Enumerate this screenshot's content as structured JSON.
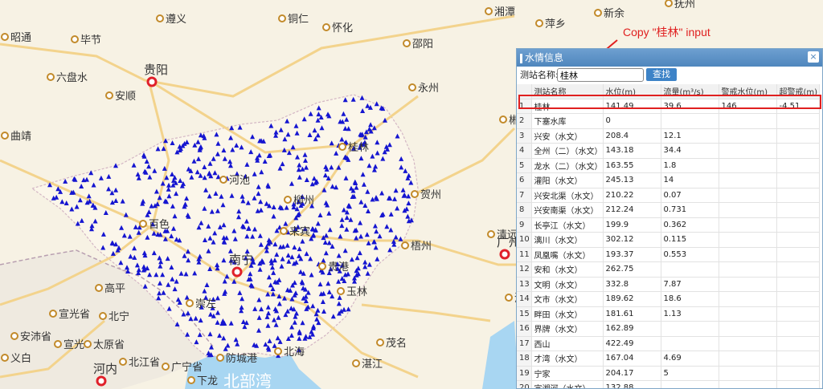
{
  "map": {
    "cities": [
      {
        "id": "zunyi",
        "name": "遵义"
      },
      {
        "id": "tongren",
        "name": "铜仁"
      },
      {
        "id": "xiangtan",
        "name": "湘潭"
      },
      {
        "id": "xinyu",
        "name": "新余"
      },
      {
        "id": "fuzhou",
        "name": "抚州"
      },
      {
        "id": "bijie",
        "name": "毕节"
      },
      {
        "id": "huaihua",
        "name": "怀化"
      },
      {
        "id": "pingxiang",
        "name": "萍乡"
      },
      {
        "id": "zhaotong",
        "name": "昭通"
      },
      {
        "id": "guiyang",
        "name": "贵阳"
      },
      {
        "id": "shaoyang",
        "name": "邵阳"
      },
      {
        "id": "liupanshui",
        "name": "六盘水"
      },
      {
        "id": "anshun",
        "name": "安顺"
      },
      {
        "id": "yongzhou",
        "name": "永州"
      },
      {
        "id": "qujing",
        "name": "曲靖"
      },
      {
        "id": "chenzhou",
        "name": "郴州"
      },
      {
        "id": "guilin",
        "name": "桂林"
      },
      {
        "id": "hechi",
        "name": "河池"
      },
      {
        "id": "liuzhou",
        "name": "柳州"
      },
      {
        "id": "hezhou",
        "name": "贺州"
      },
      {
        "id": "baise",
        "name": "百色"
      },
      {
        "id": "laibin",
        "name": "来宾"
      },
      {
        "id": "qingyuan",
        "name": "清远"
      },
      {
        "id": "wuzhou",
        "name": "梧州"
      },
      {
        "id": "nanning",
        "name": "南宁"
      },
      {
        "id": "guangzhou",
        "name": "广州"
      },
      {
        "id": "gaoping",
        "name": "高平"
      },
      {
        "id": "guigang",
        "name": "贵港"
      },
      {
        "id": "yulin",
        "name": "玉林"
      },
      {
        "id": "chongzuo",
        "name": "崇左"
      },
      {
        "id": "ao",
        "name": "澳"
      },
      {
        "id": "xuanguang_prov",
        "name": "宣光省"
      },
      {
        "id": "beining",
        "name": "北宁"
      },
      {
        "id": "anpei",
        "name": "安沛省"
      },
      {
        "id": "xuanguang",
        "name": "宣光"
      },
      {
        "id": "taiyuan",
        "name": "太原省"
      },
      {
        "id": "beijiang",
        "name": "北江省"
      },
      {
        "id": "maoming",
        "name": "茂名"
      },
      {
        "id": "fangchenggang",
        "name": "防城港"
      },
      {
        "id": "beihai",
        "name": "北海"
      },
      {
        "id": "yibai",
        "name": "义白"
      },
      {
        "id": "guangning",
        "name": "广宁省"
      },
      {
        "id": "hanoi",
        "name": "河内"
      },
      {
        "id": "zhanjiang",
        "name": "湛江"
      },
      {
        "id": "xialong",
        "name": "下龙"
      }
    ],
    "sea_label": "北部湾"
  },
  "annotation": {
    "text": "Copy \"桂林\" input"
  },
  "panel": {
    "title": "水情信息",
    "close_icon": "×",
    "search": {
      "label": "测站名称:",
      "value": "桂林",
      "button": "查找"
    },
    "columns": [
      "",
      "测站名称",
      "水位(m)",
      "流量(m³/s)",
      "警戒水位(m)",
      "超警戒(m)"
    ],
    "rows": [
      [
        "1",
        "桂林",
        "141.49",
        "39.6",
        "146",
        "-4.51"
      ],
      [
        "2",
        "下塞水库",
        "0",
        "",
        "",
        ""
      ],
      [
        "3",
        "兴安（水文）",
        "208.4",
        "12.1",
        "",
        ""
      ],
      [
        "4",
        "全州（二）（水文）",
        "143.18",
        "34.4",
        "",
        ""
      ],
      [
        "5",
        "龙水（二）（水文）",
        "163.55",
        "1.8",
        "",
        ""
      ],
      [
        "6",
        "灌阳（水文）",
        "245.13",
        "14",
        "",
        ""
      ],
      [
        "7",
        "兴安北渠（水文）",
        "210.22",
        "0.07",
        "",
        ""
      ],
      [
        "8",
        "兴安南渠（水文）",
        "212.24",
        "0.731",
        "",
        ""
      ],
      [
        "9",
        "长亭江（水文）",
        "199.9",
        "0.362",
        "",
        ""
      ],
      [
        "10",
        "漓川（水文）",
        "302.12",
        "0.115",
        "",
        ""
      ],
      [
        "11",
        "凤凰嘴（水文）",
        "193.37",
        "0.553",
        "",
        ""
      ],
      [
        "12",
        "安和（水文）",
        "262.75",
        "",
        "",
        ""
      ],
      [
        "13",
        "文明（水文）",
        "332.8",
        "7.87",
        "",
        ""
      ],
      [
        "14",
        "文市（水文）",
        "189.62",
        "18.6",
        "",
        ""
      ],
      [
        "15",
        "畔田（水文）",
        "181.61",
        "1.13",
        "",
        ""
      ],
      [
        "16",
        "界牌（水文）",
        "162.89",
        "",
        "",
        ""
      ],
      [
        "17",
        "西山",
        "422.49",
        "",
        "",
        ""
      ],
      [
        "18",
        "才湾（水文）",
        "167.04",
        "4.69",
        "",
        ""
      ],
      [
        "19",
        "宁家",
        "204.17",
        "5",
        "",
        ""
      ],
      [
        "20",
        "宣湘河（水文）",
        "132.88",
        "",
        "",
        ""
      ]
    ]
  },
  "colors": {
    "marker": "#1515d0",
    "road": "#f3d38c",
    "water": "#a8d6f2",
    "highlight": "#e02020",
    "header": "#4f86bd",
    "button": "#3d83c7"
  }
}
